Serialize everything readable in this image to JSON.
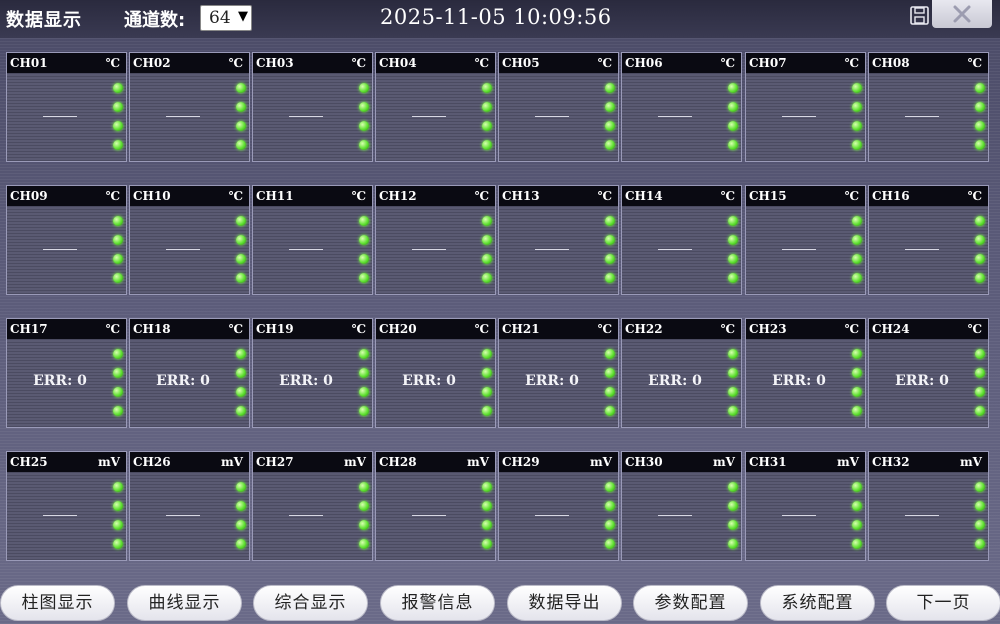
{
  "header": {
    "title": "数据显示",
    "channel_count_label": "通道数:",
    "channel_count_value": "64",
    "datetime": "2025-11-05  10:09:56"
  },
  "channels": [
    {
      "name": "CH01",
      "unit": "℃",
      "value": ""
    },
    {
      "name": "CH02",
      "unit": "℃",
      "value": ""
    },
    {
      "name": "CH03",
      "unit": "℃",
      "value": ""
    },
    {
      "name": "CH04",
      "unit": "℃",
      "value": ""
    },
    {
      "name": "CH05",
      "unit": "℃",
      "value": ""
    },
    {
      "name": "CH06",
      "unit": "℃",
      "value": ""
    },
    {
      "name": "CH07",
      "unit": "℃",
      "value": ""
    },
    {
      "name": "CH08",
      "unit": "℃",
      "value": ""
    },
    {
      "name": "CH09",
      "unit": "℃",
      "value": ""
    },
    {
      "name": "CH10",
      "unit": "℃",
      "value": ""
    },
    {
      "name": "CH11",
      "unit": "℃",
      "value": ""
    },
    {
      "name": "CH12",
      "unit": "℃",
      "value": ""
    },
    {
      "name": "CH13",
      "unit": "℃",
      "value": ""
    },
    {
      "name": "CH14",
      "unit": "℃",
      "value": ""
    },
    {
      "name": "CH15",
      "unit": "℃",
      "value": ""
    },
    {
      "name": "CH16",
      "unit": "℃",
      "value": ""
    },
    {
      "name": "CH17",
      "unit": "℃",
      "value": "ERR: 0"
    },
    {
      "name": "CH18",
      "unit": "℃",
      "value": "ERR: 0"
    },
    {
      "name": "CH19",
      "unit": "℃",
      "value": "ERR: 0"
    },
    {
      "name": "CH20",
      "unit": "℃",
      "value": "ERR: 0"
    },
    {
      "name": "CH21",
      "unit": "℃",
      "value": "ERR: 0"
    },
    {
      "name": "CH22",
      "unit": "℃",
      "value": "ERR: 0"
    },
    {
      "name": "CH23",
      "unit": "℃",
      "value": "ERR: 0"
    },
    {
      "name": "CH24",
      "unit": "℃",
      "value": "ERR: 0"
    },
    {
      "name": "CH25",
      "unit": "mV",
      "value": ""
    },
    {
      "name": "CH26",
      "unit": "mV",
      "value": ""
    },
    {
      "name": "CH27",
      "unit": "mV",
      "value": ""
    },
    {
      "name": "CH28",
      "unit": "mV",
      "value": ""
    },
    {
      "name": "CH29",
      "unit": "mV",
      "value": ""
    },
    {
      "name": "CH30",
      "unit": "mV",
      "value": ""
    },
    {
      "name": "CH31",
      "unit": "mV",
      "value": ""
    },
    {
      "name": "CH32",
      "unit": "mV",
      "value": ""
    }
  ],
  "indicator_color": "#5ee030",
  "buttons": [
    "柱图显示",
    "曲线显示",
    "综合显示",
    "报警信息",
    "数据导出",
    "参数配置",
    "系统配置",
    "下一页"
  ]
}
